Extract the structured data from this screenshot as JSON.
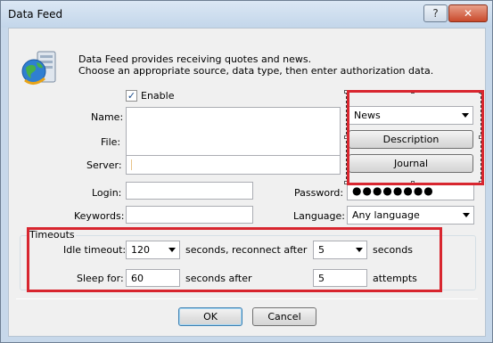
{
  "window": {
    "title": "Data Feed",
    "help_glyph": "?",
    "close_glyph": "✕"
  },
  "header": {
    "line1": "Data Feed provides receiving quotes and news.",
    "line2": "Choose an appropriate source, data type, then enter authorization data.",
    "icon": "globe-server-icon"
  },
  "enable": {
    "label": "Enable",
    "checked": true,
    "check_glyph": "✓"
  },
  "fields": {
    "name_label": "Name:",
    "name_value": "",
    "file_label": "File:",
    "file_value": "",
    "server_label": "Server:",
    "server_value": "",
    "login_label": "Login:",
    "login_value": "",
    "password_label": "Password:",
    "password_value": "●●●●●●●●",
    "keywords_label": "Keywords:",
    "keywords_value": "",
    "language_label": "Language:",
    "language_value": "Any language"
  },
  "right_panel": {
    "type_value": "News",
    "description_label": "Description",
    "journal_label": "Journal"
  },
  "timeouts": {
    "group_title": "Timeouts",
    "idle_label": "Idle timeout:",
    "idle_value": "120",
    "reconnect_text": "seconds, reconnect after",
    "reconnect_value": "5",
    "seconds_text": "seconds",
    "sleep_label": "Sleep for:",
    "sleep_value": "60",
    "seconds_after_text": "seconds after",
    "attempts_value": "5",
    "attempts_text": "attempts"
  },
  "footer": {
    "ok_label": "OK",
    "cancel_label": "Cancel"
  },
  "colors": {
    "highlight_red": "#d8262f",
    "window_frame": "#c7d8ea"
  }
}
